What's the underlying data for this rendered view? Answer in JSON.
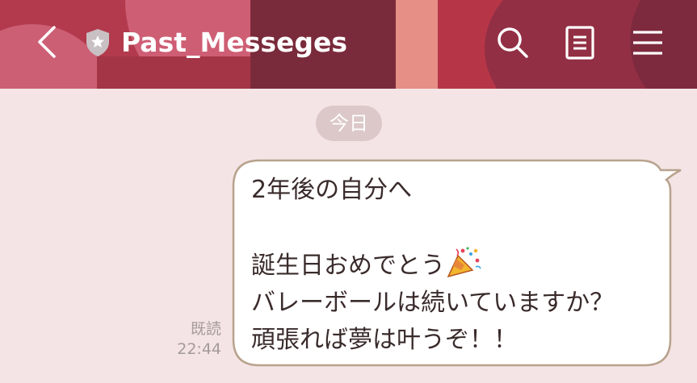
{
  "header": {
    "title": "Past_Messeges",
    "icons": {
      "back": "chevron-left-icon",
      "badge": "shield-star-icon",
      "search": "search-icon",
      "notes": "notes-icon",
      "menu": "hamburger-menu-icon"
    },
    "colors": {
      "background": "#b23a4c",
      "foreground": "#ffffff"
    }
  },
  "chat": {
    "date_separator": "今日",
    "messages": [
      {
        "direction": "outgoing",
        "lines": [
          "2年後の自分へ",
          "",
          "誕生日おめでとう",
          "バレーボールは続いていますか？",
          "頑張れば夢は叶うぞ！！"
        ],
        "emoji": "party-popper",
        "read_label": "既読",
        "time": "22:44"
      }
    ],
    "colors": {
      "background": "#f4e4e5",
      "bubble_border": "#b8a28d",
      "bubble_fill": "#ffffff",
      "text": "#3a2b2b",
      "meta_text": "#a59a9a"
    }
  }
}
